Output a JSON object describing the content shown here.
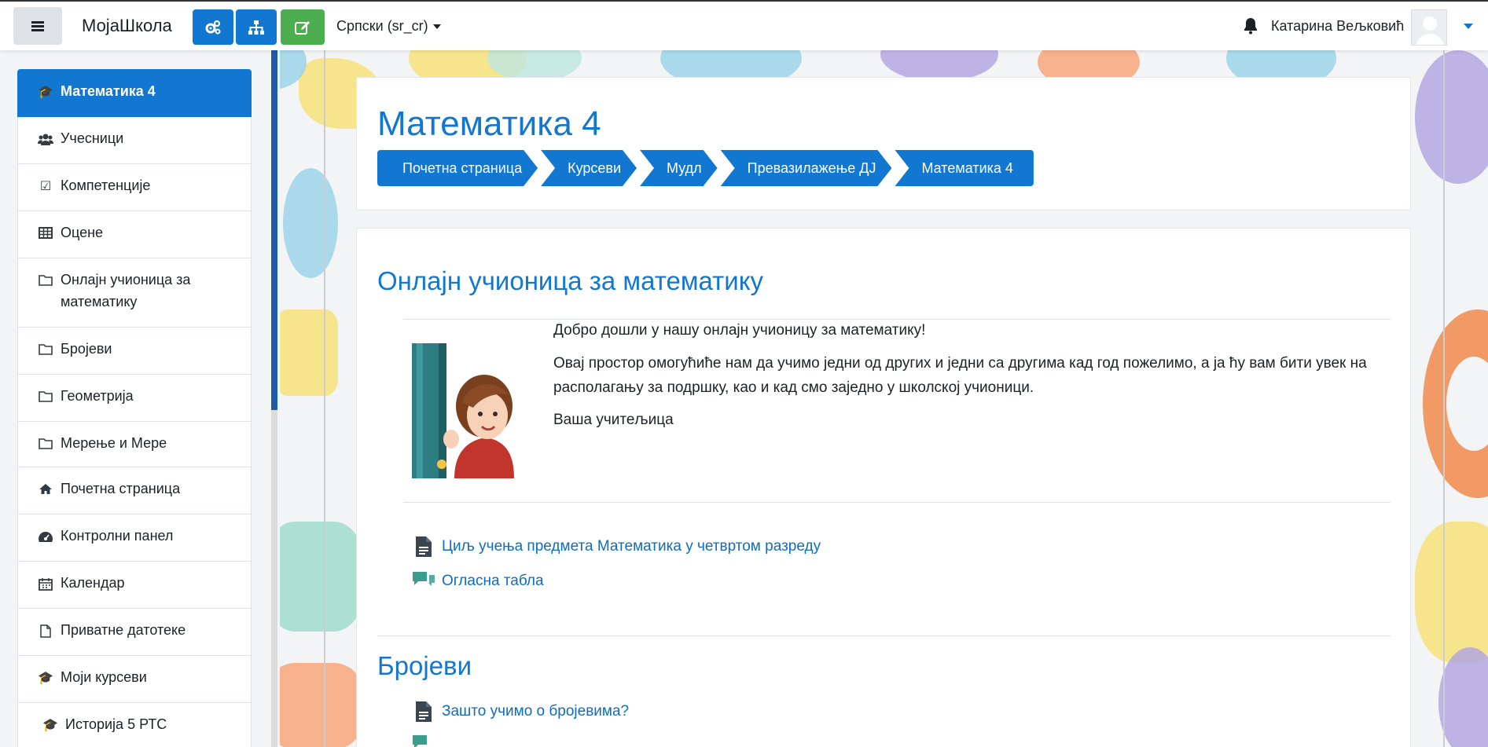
{
  "navbar": {
    "brand": "МојаШкола",
    "language": "Српски (sr_cr)",
    "user_name": "Катарина Вељковић"
  },
  "drawer": {
    "course_items": [
      {
        "label": "Математика 4",
        "icon": "graduation-cap-icon",
        "active": true
      },
      {
        "label": "Учесници",
        "icon": "users-icon"
      },
      {
        "label": "Компетенције",
        "icon": "check-square-icon"
      },
      {
        "label": "Оцене",
        "icon": "table-icon"
      },
      {
        "label": "Онлајн учионица за математику",
        "icon": "folder-icon"
      },
      {
        "label": "Бројеви",
        "icon": "folder-icon"
      },
      {
        "label": "Геометрија",
        "icon": "folder-icon"
      },
      {
        "label": "Мерење и Мере",
        "icon": "folder-icon"
      }
    ],
    "site_items": [
      {
        "label": "Почетна страница",
        "icon": "home-icon"
      },
      {
        "label": "Контролни панел",
        "icon": "dashboard-icon"
      },
      {
        "label": "Календар",
        "icon": "calendar-icon"
      },
      {
        "label": "Приватне датотеке",
        "icon": "file-icon"
      },
      {
        "label": "Моји курсеви",
        "icon": "graduation-cap-icon"
      },
      {
        "label": "Историја 5 РТС",
        "icon": "graduation-cap-icon"
      }
    ]
  },
  "header": {
    "title": "Математика 4",
    "breadcrumb": [
      "Почетна страница",
      "Курсеви",
      "Мудл",
      "Превазилажење ДЈ",
      "Математика 4"
    ]
  },
  "sections": {
    "intro_title": "Онлајн учионица за математику",
    "welcome_p1": "Добро дошли у нашу онлајн учионицу за математику!",
    "welcome_p2": "Овај простор омогућиће нам да учимо једни од других и једни са другима кад год пожелимо, а ја ћу вам бити увек на располагању за подршку, као и кад смо заједно у школској учионици.",
    "welcome_p3": "Ваша учитељица",
    "intro_activities": [
      {
        "label": "Циљ учења предмета Математика у четвртом разреду",
        "icon": "page-icon"
      },
      {
        "label": "Огласна табла",
        "icon": "forum-icon"
      }
    ],
    "numbers_title": "Бројеви",
    "numbers_activities": [
      {
        "label": "Зашто учимо о бројевима?",
        "icon": "page-icon"
      }
    ]
  },
  "colors": {
    "primary": "#1177d1",
    "success": "#4cae4f",
    "drawer_scroll": "#1f5aa6"
  }
}
